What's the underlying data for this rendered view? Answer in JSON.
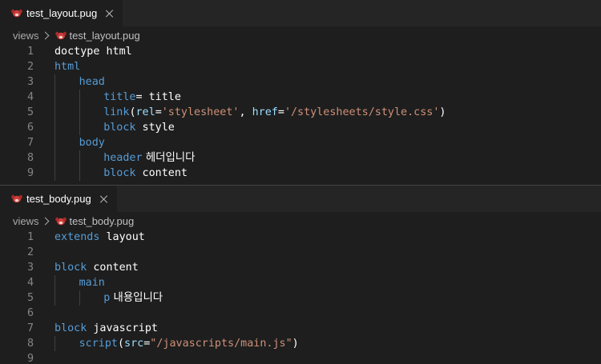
{
  "top_pane": {
    "tab_label": "test_layout.pug",
    "breadcrumb": {
      "folder": "views",
      "file": "test_layout.pug"
    },
    "lines": [
      {
        "n": "1",
        "indent": 0,
        "tokens": [
          {
            "t": "doctype",
            "c": "plain"
          },
          {
            "t": " html",
            "c": "plain"
          }
        ]
      },
      {
        "n": "2",
        "indent": 0,
        "tokens": [
          {
            "t": "html",
            "c": "tag"
          }
        ]
      },
      {
        "n": "3",
        "indent": 1,
        "tokens": [
          {
            "t": "head",
            "c": "tag"
          }
        ]
      },
      {
        "n": "4",
        "indent": 2,
        "tokens": [
          {
            "t": "title",
            "c": "tag"
          },
          {
            "t": "= title",
            "c": "plain"
          }
        ]
      },
      {
        "n": "5",
        "indent": 2,
        "tokens": [
          {
            "t": "link",
            "c": "tag"
          },
          {
            "t": "(",
            "c": "plain"
          },
          {
            "t": "rel",
            "c": "attr"
          },
          {
            "t": "=",
            "c": "plain"
          },
          {
            "t": "'stylesheet'",
            "c": "str"
          },
          {
            "t": ", ",
            "c": "plain"
          },
          {
            "t": "href",
            "c": "attr"
          },
          {
            "t": "=",
            "c": "plain"
          },
          {
            "t": "'/stylesheets/style.css'",
            "c": "str"
          },
          {
            "t": ")",
            "c": "plain"
          }
        ]
      },
      {
        "n": "6",
        "indent": 2,
        "tokens": [
          {
            "t": "block",
            "c": "kw"
          },
          {
            "t": " style",
            "c": "plain"
          }
        ]
      },
      {
        "n": "7",
        "indent": 1,
        "tokens": [
          {
            "t": "body",
            "c": "tag"
          }
        ]
      },
      {
        "n": "8",
        "indent": 2,
        "tokens": [
          {
            "t": "header",
            "c": "tag"
          },
          {
            "t": " 헤더입니다",
            "c": "kor"
          }
        ]
      },
      {
        "n": "9",
        "indent": 2,
        "tokens": [
          {
            "t": "block",
            "c": "kw"
          },
          {
            "t": " content",
            "c": "plain"
          }
        ]
      }
    ]
  },
  "bottom_pane": {
    "tab_label": "test_body.pug",
    "breadcrumb": {
      "folder": "views",
      "file": "test_body.pug"
    },
    "lines": [
      {
        "n": "1",
        "indent": 0,
        "tokens": [
          {
            "t": "extends",
            "c": "kw"
          },
          {
            "t": " layout",
            "c": "plain"
          }
        ]
      },
      {
        "n": "2",
        "indent": 0,
        "tokens": []
      },
      {
        "n": "3",
        "indent": 0,
        "tokens": [
          {
            "t": "block",
            "c": "kw"
          },
          {
            "t": " content",
            "c": "plain"
          }
        ]
      },
      {
        "n": "4",
        "indent": 1,
        "tokens": [
          {
            "t": "main",
            "c": "tag"
          }
        ]
      },
      {
        "n": "5",
        "indent": 2,
        "tokens": [
          {
            "t": "p",
            "c": "tag"
          },
          {
            "t": " 내용입니다",
            "c": "kor"
          }
        ]
      },
      {
        "n": "6",
        "indent": 0,
        "tokens": []
      },
      {
        "n": "7",
        "indent": 0,
        "tokens": [
          {
            "t": "block",
            "c": "kw"
          },
          {
            "t": " javascript",
            "c": "plain"
          }
        ]
      },
      {
        "n": "8",
        "indent": 1,
        "tokens": [
          {
            "t": "script",
            "c": "tag"
          },
          {
            "t": "(",
            "c": "plain"
          },
          {
            "t": "src",
            "c": "attr"
          },
          {
            "t": "=",
            "c": "plain"
          },
          {
            "t": "\"/javascripts/main.js\"",
            "c": "str"
          },
          {
            "t": ")",
            "c": "plain"
          }
        ]
      },
      {
        "n": "9",
        "indent": 0,
        "tokens": []
      }
    ]
  },
  "icons": {
    "file_icon": "pug-icon",
    "close_icon": "close-icon",
    "chevron_icon": "chevron-right-icon"
  },
  "colors": {
    "tag": "#569cd6",
    "attribute": "#9cdcfe",
    "string": "#ce9178",
    "text": "#ffffff",
    "line_number": "#858585",
    "editor_bg": "#1e1e1e",
    "tabbar_bg": "#252526",
    "pug_icon": "#cf3d3d"
  }
}
